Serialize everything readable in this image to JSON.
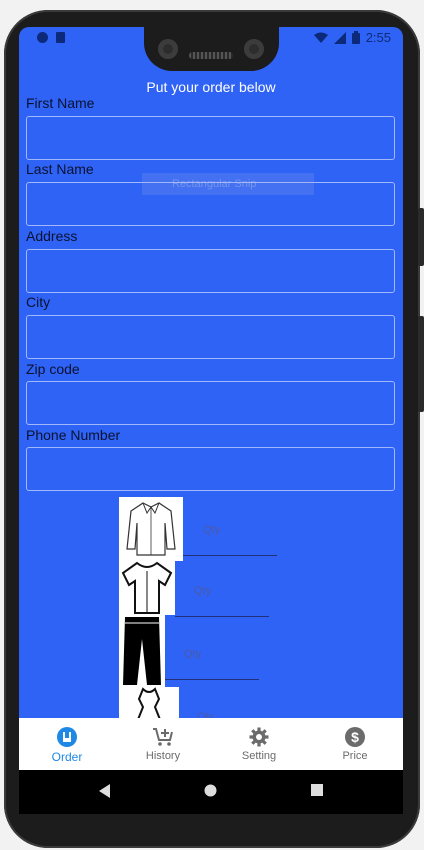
{
  "status": {
    "time": "2:55"
  },
  "header": {
    "title": "Put your order below"
  },
  "form": {
    "fields": [
      {
        "label": "First Name",
        "value": ""
      },
      {
        "label": "Last Name",
        "value": ""
      },
      {
        "label": "Address",
        "value": ""
      },
      {
        "label": "City",
        "value": ""
      },
      {
        "label": "Zip code",
        "value": ""
      },
      {
        "label": "Phone Number",
        "value": ""
      }
    ],
    "overlay_text": "Rectangular Snip"
  },
  "items": [
    {
      "name": "shirt",
      "qty_placeholder": "Qty"
    },
    {
      "name": "blouse",
      "qty_placeholder": "Qty"
    },
    {
      "name": "pants",
      "qty_placeholder": "Qty"
    },
    {
      "name": "dress",
      "qty_placeholder": "Qty"
    }
  ],
  "bottom_nav": {
    "tabs": [
      {
        "label": "Order",
        "icon": "order-icon",
        "active": true
      },
      {
        "label": "History",
        "icon": "cart-add-icon",
        "active": false
      },
      {
        "label": "Setting",
        "icon": "gear-icon",
        "active": false
      },
      {
        "label": "Price",
        "icon": "dollar-icon",
        "active": false
      }
    ]
  },
  "colors": {
    "screen_bg": "#2f63f6",
    "active_tab": "#1e88e5"
  }
}
